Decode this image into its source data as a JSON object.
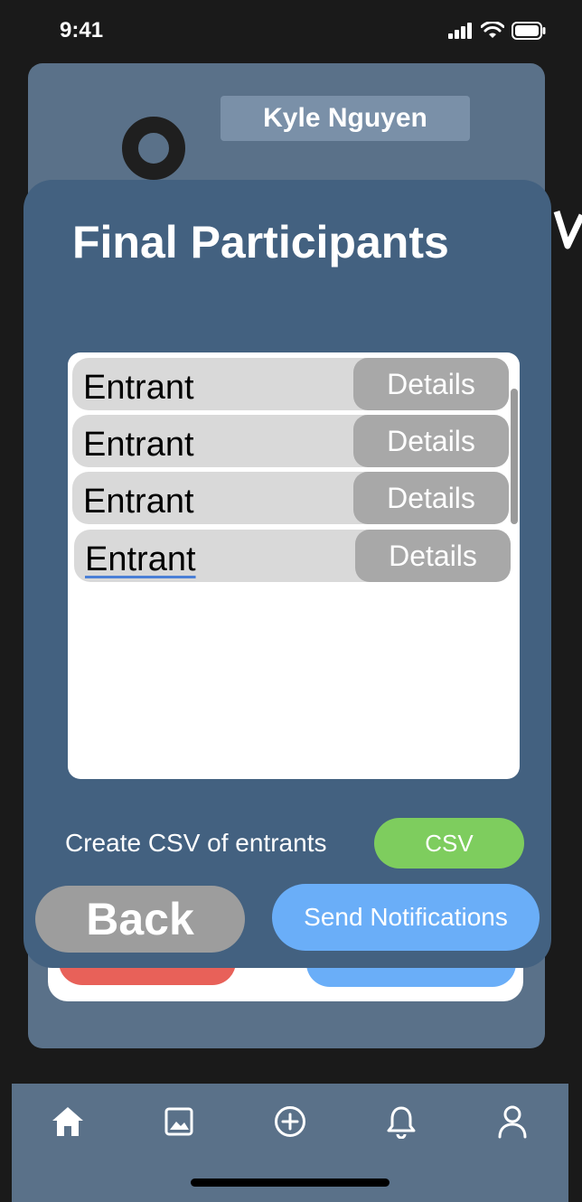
{
  "status_bar": {
    "time": "9:41"
  },
  "profile": {
    "name": "Kyle Nguyen"
  },
  "modal": {
    "title": "Final Participants",
    "entrants": [
      {
        "label": "Entrant",
        "button": "Details"
      },
      {
        "label": "Entrant",
        "button": "Details"
      },
      {
        "label": "Entrant",
        "button": "Details"
      },
      {
        "label": "Entrant",
        "button": "Details"
      }
    ],
    "csv_label": "Create CSV of entrants",
    "csv_button": "CSV",
    "back_button": "Back",
    "send_button": "Send Notifications"
  },
  "tabbar": {
    "icons": [
      "home-icon",
      "image-icon",
      "add-circle-icon",
      "bell-icon",
      "user-icon"
    ]
  },
  "colors": {
    "modal_bg": "#436180",
    "card_bg": "#5a7189",
    "csv_green": "#7ecd5e",
    "send_blue": "#6aaef8",
    "back_gray": "#9d9d9d"
  }
}
